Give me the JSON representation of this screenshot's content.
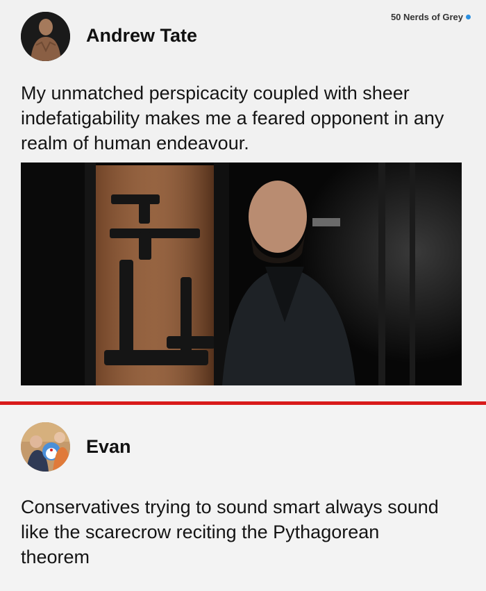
{
  "watermark": {
    "text": "50 Nerds of Grey",
    "dot_color": "#2a8fe0"
  },
  "top_post": {
    "author": "Andrew Tate",
    "text": "My unmatched perspicacity coupled with sheer indefatigability makes me a feared opponent in any realm of human endeavour.",
    "avatar_icon": "profile-photo-icon",
    "image_icon": "photo-icon"
  },
  "divider_color": "#d81a1a",
  "bottom_post": {
    "author": "Evan",
    "text": "Conservatives trying to sound smart always sound like the scarecrow reciting the Pythagorean theorem",
    "avatar_icon": "profile-photo-icon"
  }
}
